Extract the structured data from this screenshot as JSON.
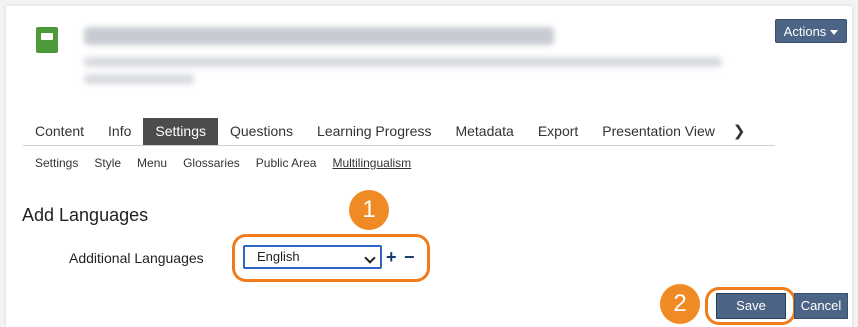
{
  "header": {
    "actions_label": "Actions",
    "icon": "book-icon"
  },
  "tabs": [
    {
      "label": "Content"
    },
    {
      "label": "Info"
    },
    {
      "label": "Settings"
    },
    {
      "label": "Questions"
    },
    {
      "label": "Learning Progress"
    },
    {
      "label": "Metadata"
    },
    {
      "label": "Export"
    },
    {
      "label": "Presentation View"
    }
  ],
  "subtabs": [
    {
      "label": "Settings"
    },
    {
      "label": "Style"
    },
    {
      "label": "Menu"
    },
    {
      "label": "Glossaries"
    },
    {
      "label": "Public Area"
    },
    {
      "label": "Multilingualism"
    }
  ],
  "main": {
    "section_title": "Add Languages",
    "field_label": "Additional Languages",
    "selected_language": "English",
    "plus_label": "+",
    "minus_label": "−",
    "save_label": "Save",
    "cancel_label": "Cancel"
  },
  "callouts": {
    "one": "1",
    "two": "2"
  },
  "colors": {
    "accent_orange": "#f08a24",
    "button_blue": "#4c6586",
    "active_tab": "#4c4c4c",
    "focus_blue": "#2e63c7"
  }
}
